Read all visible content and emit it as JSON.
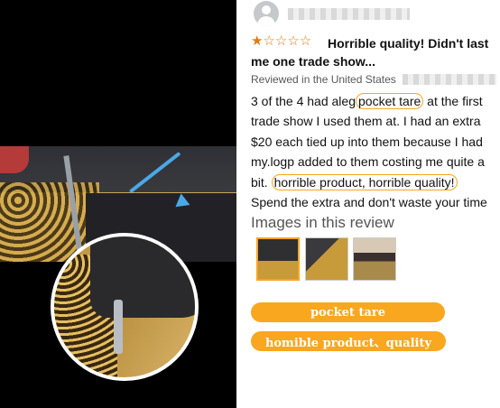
{
  "review": {
    "rating_stars": {
      "filled": "★",
      "empty": "☆☆☆☆"
    },
    "title_line1": "Horrible quality! Didn't last",
    "title_line2": "me one trade show...",
    "reviewed_in": "Reviewed in the United States",
    "body": {
      "part1": "3 of the 4 had aleg",
      "hl1": "pocket tare",
      "part2": "at the first trade show I used them at. I had an extra $20 each tied up into them because I had my.logp added to them costing me quite a bit.",
      "hl2": "horrible product, horrible quality!",
      "part3": "Spend the extra and don't waste your time"
    },
    "images_heading": "Images in this review"
  },
  "tags": {
    "tag1": "pocket tare",
    "tag2": "homible product、quality"
  },
  "colors": {
    "accent": "#f9a71f",
    "star": "#e47911",
    "arrow": "#4aa8e8"
  }
}
